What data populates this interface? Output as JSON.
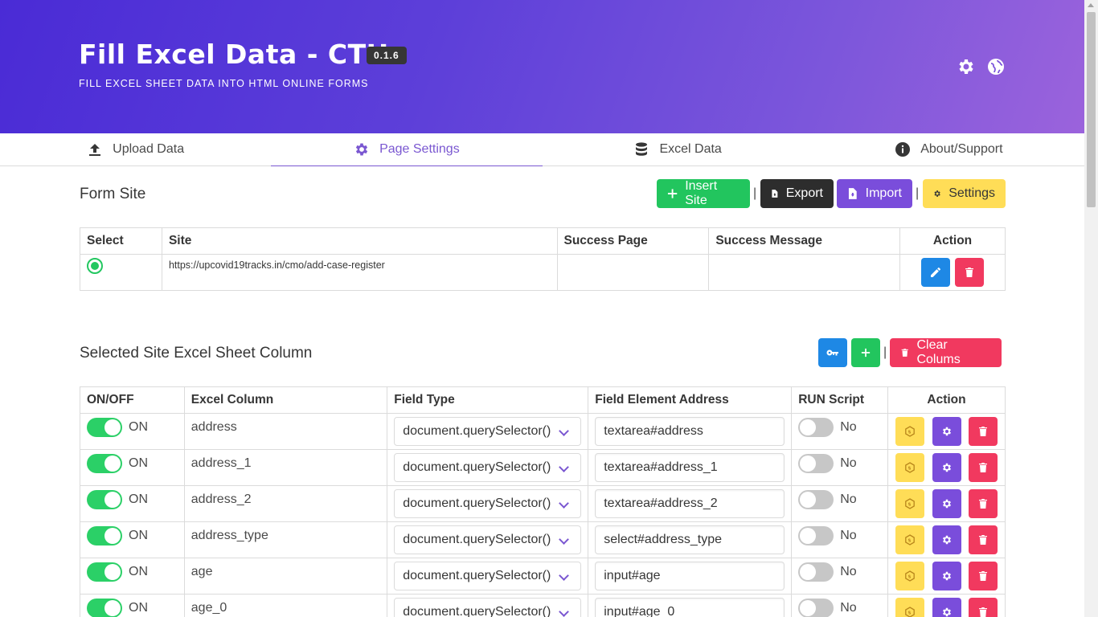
{
  "header": {
    "title": "Fill Excel Data - CTH",
    "version": "0.1.6",
    "subtitle": "FILL EXCEL SHEET DATA INTO HTML ONLINE FORMS",
    "icons": [
      "gear-icon",
      "globe-icon"
    ]
  },
  "tabs": [
    {
      "label": "Upload Data",
      "icon": "upload-icon"
    },
    {
      "label": "Page Settings",
      "icon": "gear-icon",
      "active": true
    },
    {
      "label": "Excel Data",
      "icon": "database-icon"
    },
    {
      "label": "About/Support",
      "icon": "info-icon"
    }
  ],
  "form_site": {
    "title": "Form Site",
    "buttons": {
      "insert": "Insert Site",
      "export": "Export",
      "import": "Import",
      "settings": "Settings"
    },
    "separator": "|",
    "headers": [
      "Select",
      "Site",
      "Success Page",
      "Success Message",
      "Action"
    ],
    "rows": [
      {
        "selected": true,
        "site": "https://upcovid19tracks.in/cmo/add-case-register",
        "success_page": "",
        "success_message": ""
      }
    ]
  },
  "columns_section": {
    "title": "Selected Site Excel Sheet Column",
    "clear_label": "Clear Colums",
    "headers": [
      "ON/OFF",
      "Excel Column",
      "Field Type",
      "Field Element Address",
      "RUN Script",
      "Action"
    ],
    "rows": [
      {
        "on": true,
        "on_label": "ON",
        "column": "address",
        "field_type": "document.querySelector()",
        "address": "textarea#address",
        "run": false,
        "run_label": "No"
      },
      {
        "on": true,
        "on_label": "ON",
        "column": "address_1",
        "field_type": "document.querySelector()",
        "address": "textarea#address_1",
        "run": false,
        "run_label": "No"
      },
      {
        "on": true,
        "on_label": "ON",
        "column": "address_2",
        "field_type": "document.querySelector()",
        "address": "textarea#address_2",
        "run": false,
        "run_label": "No"
      },
      {
        "on": true,
        "on_label": "ON",
        "column": "address_type",
        "field_type": "document.querySelector()",
        "address": "select#address_type",
        "run": false,
        "run_label": "No"
      },
      {
        "on": true,
        "on_label": "ON",
        "column": "age",
        "field_type": "document.querySelector()",
        "address": "input#age",
        "run": false,
        "run_label": "No"
      },
      {
        "on": true,
        "on_label": "ON",
        "column": "age_0",
        "field_type": "document.querySelector()",
        "address": "input#age_0",
        "run": false,
        "run_label": "No"
      }
    ]
  },
  "colors": {
    "primary": "#7a57d1",
    "success": "#22c55e",
    "danger": "#f1395f",
    "info": "#1e88e5",
    "warning": "#ffdd57",
    "dark": "#2d2d2d",
    "import": "#7a4ddb"
  }
}
